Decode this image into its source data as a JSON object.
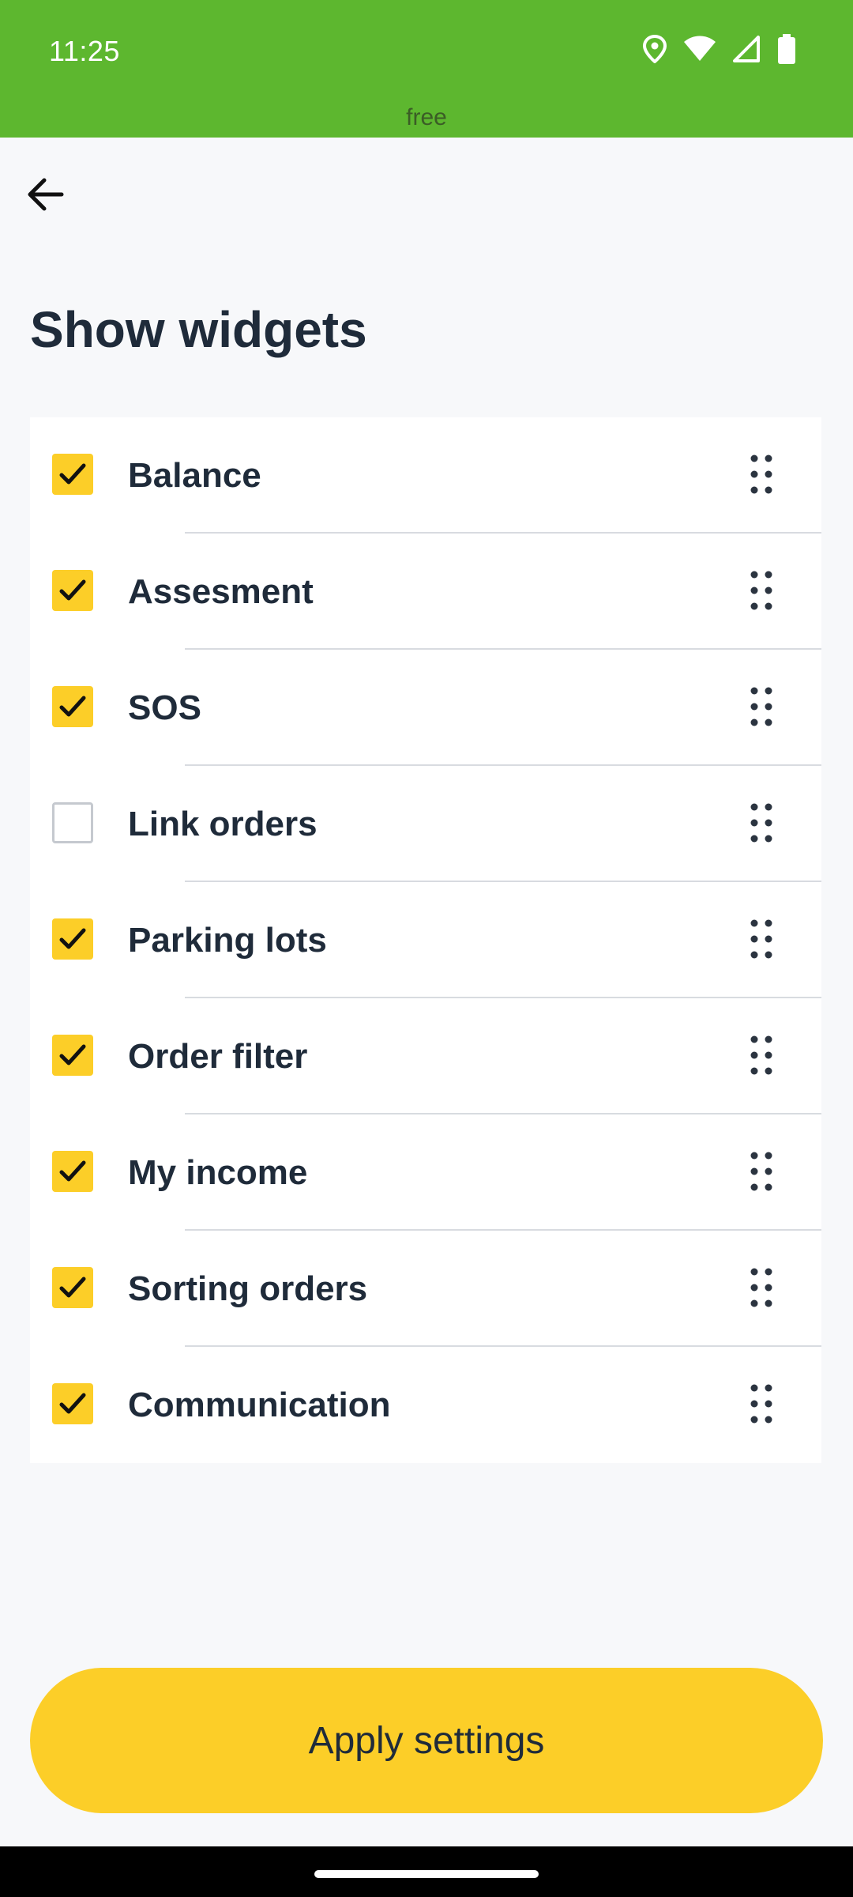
{
  "status_bar": {
    "time": "11:25",
    "subtitle": "free",
    "icons": [
      "location-icon",
      "wifi-icon",
      "signal-icon",
      "battery-icon"
    ],
    "background_color": "#5db72f"
  },
  "toolbar": {
    "back_icon": "arrow-back-icon"
  },
  "page": {
    "title": "Show widgets"
  },
  "widgets": [
    {
      "label": "Balance",
      "checked": true
    },
    {
      "label": "Assesment",
      "checked": true
    },
    {
      "label": "SOS",
      "checked": true
    },
    {
      "label": "Link orders",
      "checked": false
    },
    {
      "label": "Parking lots",
      "checked": true
    },
    {
      "label": "Order filter",
      "checked": true
    },
    {
      "label": "My income",
      "checked": true
    },
    {
      "label": "Sorting orders",
      "checked": true
    },
    {
      "label": "Communication",
      "checked": true
    }
  ],
  "actions": {
    "apply_label": "Apply settings"
  },
  "colors": {
    "accent": "#fcce28",
    "text": "#1f2b3a",
    "status_green": "#5db72f"
  }
}
